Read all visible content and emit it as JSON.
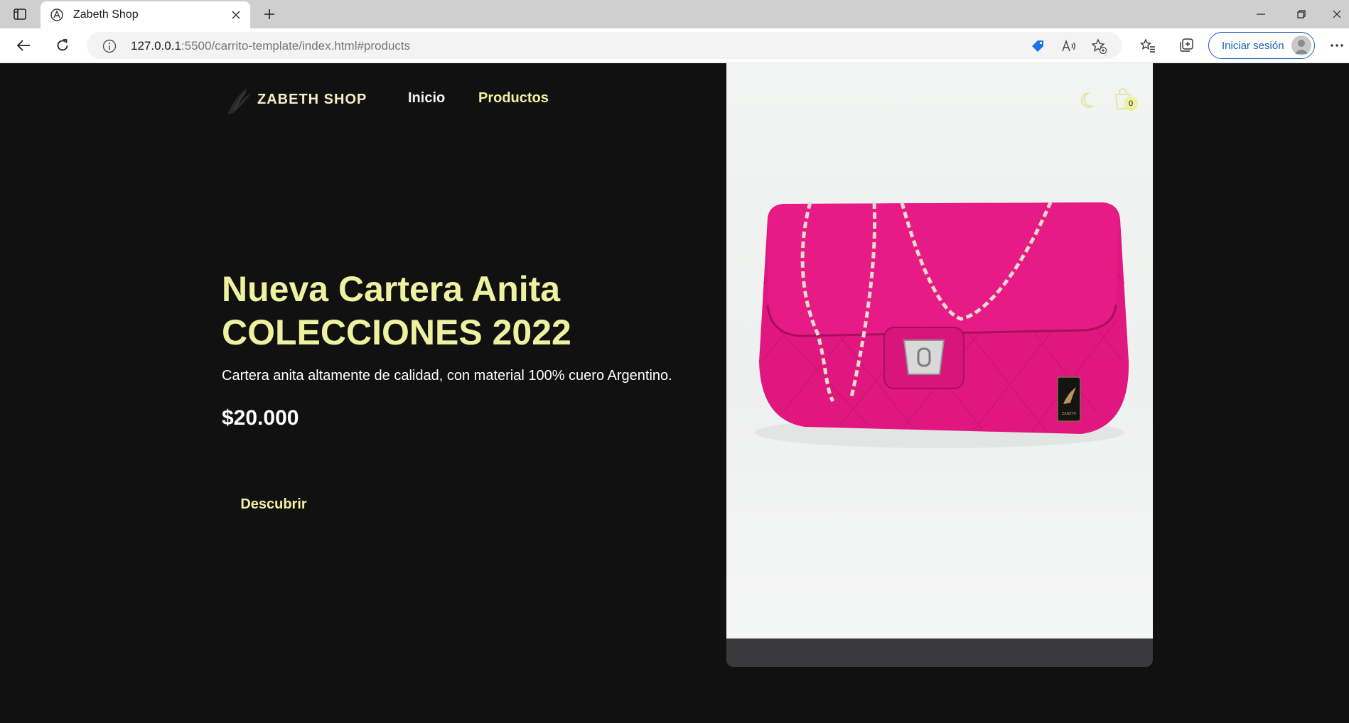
{
  "browser": {
    "tab": {
      "title": "Zabeth Shop"
    },
    "address": {
      "url_host": "127.0.0.1",
      "url_path": ":5500/carrito-template/index.html#products"
    },
    "signin_label": "Iniciar sesión"
  },
  "header": {
    "brand": "ZABETH SHOP",
    "nav": {
      "home": "Inicio",
      "products": "Productos"
    },
    "cart_count": "0"
  },
  "hero": {
    "title_line1": "Nueva Cartera Anita",
    "title_line2": "COLECCIONES 2022",
    "description": "Cartera anita altamente de calidad, con material 100% cuero Argentino.",
    "price": "$20.000",
    "button_label": "Descubrir"
  },
  "product_image": {
    "bag_color": "#e0177f",
    "label": "ZABETH"
  },
  "colors": {
    "accent": "#eef2a0",
    "background": "#121111",
    "panel": "#3a393b"
  }
}
